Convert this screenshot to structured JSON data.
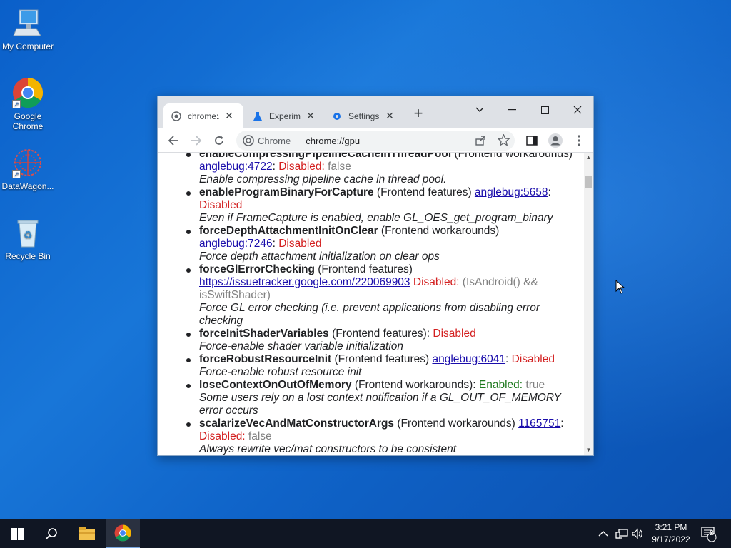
{
  "desktop": {
    "icons": [
      {
        "label": "My Computer",
        "icon": "computer-icon"
      },
      {
        "label": "Google Chrome",
        "icon": "chrome-icon"
      },
      {
        "label": "DataWagon...",
        "icon": "datawagon-icon"
      },
      {
        "label": "Recycle Bin",
        "icon": "recycle-bin-icon"
      }
    ]
  },
  "browser": {
    "tabs": [
      {
        "label": "chrome://gpu",
        "icon": "globe-icon",
        "active": true
      },
      {
        "label": "Experiments",
        "icon": "flask-icon",
        "active": false
      },
      {
        "label": "Settings",
        "icon": "gear-icon",
        "active": false
      }
    ],
    "omnibox": {
      "site_label": "Chrome",
      "url": "chrome://gpu"
    },
    "features": [
      {
        "name": "enableCompressingPipelineCacheInThreadPool",
        "category": " (Frontend workarounds) ",
        "link": "anglebug:4722",
        "sep": ": ",
        "status": "Disabled:",
        "extra": " false",
        "desc": "Enable compressing pipeline cache in thread pool."
      },
      {
        "name": "enableProgramBinaryForCapture",
        "category": " (Frontend features) ",
        "link": "anglebug:5658",
        "sep": ": ",
        "status": "Disabled",
        "extra": "",
        "desc": "Even if FrameCapture is enabled, enable GL_OES_get_program_binary"
      },
      {
        "name": "forceDepthAttachmentInitOnClear",
        "category": " (Frontend workarounds) ",
        "link": "anglebug:7246",
        "sep": ": ",
        "status": "Disabled",
        "extra": "",
        "desc": "Force depth attachment initialization on clear ops"
      },
      {
        "name": "forceGlErrorChecking",
        "category": " (Frontend features) ",
        "link": "https://issuetracker.google.com/220069903",
        "sep": " ",
        "status": "Disabled:",
        "extra": " (IsAndroid() && isSwiftShader)",
        "desc": "Force GL error checking (i.e. prevent applications from disabling error checking"
      },
      {
        "name": "forceInitShaderVariables",
        "category": " (Frontend features): ",
        "link": "",
        "sep": "",
        "status": "Disabled",
        "extra": "",
        "desc": "Force-enable shader variable initialization"
      },
      {
        "name": "forceRobustResourceInit",
        "category": " (Frontend features) ",
        "link": "anglebug:6041",
        "sep": ": ",
        "status": "Disabled",
        "extra": "",
        "desc": "Force-enable robust resource init"
      },
      {
        "name": "loseContextOnOutOfMemory",
        "category": " (Frontend workarounds): ",
        "link": "",
        "sep": "",
        "status": "Enabled:",
        "extra": " true",
        "status_kind": "enabled",
        "desc": "Some users rely on a lost context notification if a GL_OUT_OF_MEMORY error occurs"
      },
      {
        "name": "scalarizeVecAndMatConstructorArgs",
        "category": " (Frontend workarounds) ",
        "link": "1165751",
        "sep": ": ",
        "status": "Disabled:",
        "extra": " false",
        "desc": "Always rewrite vec/mat constructors to be consistent"
      }
    ]
  },
  "taskbar": {
    "clock_time": "3:21 PM",
    "clock_date": "9/17/2022",
    "notification_count": "2"
  }
}
